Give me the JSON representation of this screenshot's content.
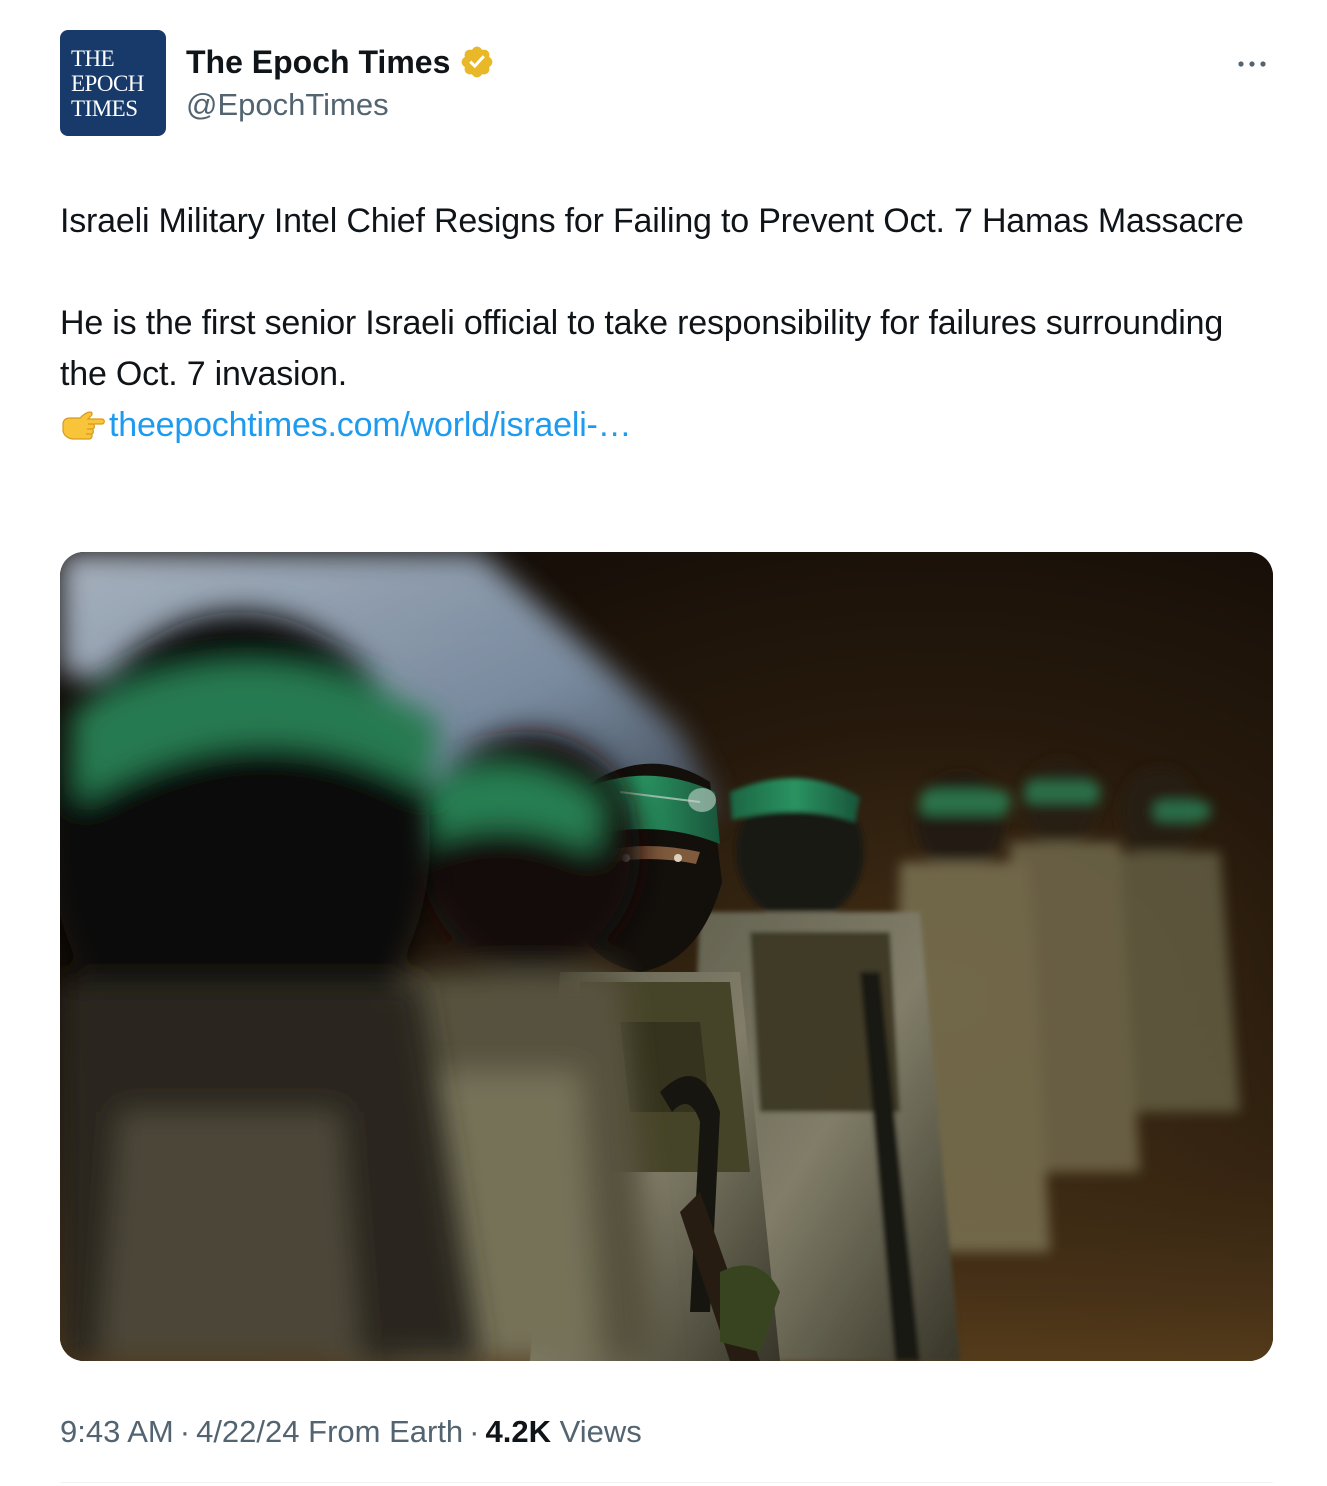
{
  "account": {
    "avatar_lines": [
      "THE",
      "EPOCH",
      "TIMES"
    ],
    "display_name": "The Epoch Times",
    "handle": "@EpochTimes",
    "verified_badge_color": "#e8b828"
  },
  "menu": {
    "more_icon": "ellipsis-icon"
  },
  "tweet": {
    "headline": "Israeli Military Intel Chief Resigns for Failing to Prevent Oct. 7 Hamas Massacre",
    "summary": "He is the first senior Israeli official to take responsibility for failures surrounding the Oct. 7 invasion.",
    "link_emoji": "pointing-finger-icon",
    "link_text": "theepochtimes.com/world/israeli-…"
  },
  "meta": {
    "time": "9:43 AM",
    "separator": "·",
    "date": "4/22/24",
    "source": "From Earth",
    "views_count": "4.2K",
    "views_label": "Views"
  },
  "colors": {
    "text_primary": "#0f1419",
    "text_secondary": "#536471",
    "link": "#1d9bf0",
    "avatar_bg": "#173a6b",
    "divider": "#eff3f4"
  }
}
